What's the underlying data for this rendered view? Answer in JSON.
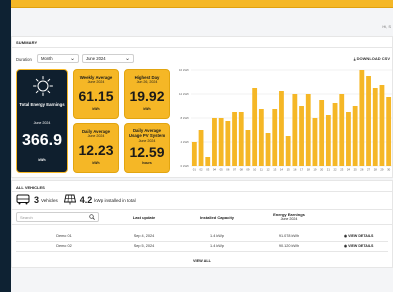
{
  "page": {
    "user_hint": "Hi, S"
  },
  "summary": {
    "title": "SUMMARY",
    "duration_label": "Duration",
    "duration_value": "Month",
    "period_value": "June 2024",
    "download_label": "DOWNLOAD CSV",
    "total": {
      "title": "Total Energy Earnings",
      "period": "June 2024",
      "value": "366.9",
      "unit": "kWh"
    },
    "weekly": {
      "title": "Weekly Average",
      "period": "June 2024",
      "value": "61.15",
      "unit": "kWh"
    },
    "highest": {
      "title": "Highest Day",
      "period": "Jun 26, 2024",
      "value": "19.92",
      "unit": "kWh"
    },
    "daily": {
      "title": "Daily Average",
      "period": "June 2024",
      "value": "12.23",
      "unit": "kWh"
    },
    "pv_usage": {
      "title": "Daily Average Usage PV System",
      "period": "June 2024",
      "value": "12.59",
      "unit": "hours"
    }
  },
  "chart_data": {
    "type": "bar",
    "categories": [
      "01",
      "02",
      "03",
      "04",
      "05",
      "06",
      "07",
      "08",
      "09",
      "10",
      "11",
      "12",
      "13",
      "14",
      "15",
      "16",
      "17",
      "18",
      "19",
      "20",
      "21",
      "22",
      "23",
      "24",
      "25",
      "26",
      "27",
      "28",
      "29",
      "30"
    ],
    "values": [
      4.0,
      6.0,
      1.5,
      8.0,
      8.0,
      7.5,
      9.0,
      9.0,
      6.0,
      13.0,
      9.5,
      5.5,
      9.5,
      12.5,
      5.0,
      12.0,
      10.0,
      12.0,
      8.0,
      11.0,
      8.5,
      10.5,
      12.0,
      9.0,
      10.0,
      19.92,
      15.0,
      13.0,
      13.5,
      11.5
    ],
    "ylim": [
      0,
      16
    ],
    "yticks": [
      "16 kWh",
      "12 kWh",
      "8 kWh",
      "4 kWh",
      "0 kWh"
    ],
    "ytick_values": [
      16,
      12,
      8,
      4,
      0
    ],
    "grid": true,
    "bar_color": "#f5b726"
  },
  "vehicles": {
    "title": "ALL VEHICLES",
    "count": "3",
    "count_label": "Vehicles",
    "installed": "4.2",
    "installed_label": "kWp installed in total",
    "search_placeholder": "Search",
    "columns": [
      "Last update",
      "Installed Capacity",
      "Energy Earnings",
      "June 2024"
    ],
    "rows": [
      {
        "name": "Demo 01",
        "last_update": "Sep 4, 2024",
        "capacity": "1.4 kWp",
        "earnings": "91.078 kWh",
        "action": "VIEW DETAILS"
      },
      {
        "name": "Demo 02",
        "last_update": "Sep 5, 2024",
        "capacity": "1.4 kWp",
        "earnings": "90.120 kWh",
        "action": "VIEW DETAILS"
      }
    ],
    "view_all": "VIEW ALL"
  },
  "colors": {
    "accent": "#f5b726",
    "dark": "#0f1f2e",
    "sidebar": "#0e2233"
  },
  "icons": [
    "sun-icon",
    "search-icon",
    "chevron-down-icon",
    "download-icon",
    "car-icon",
    "solar-panel-icon",
    "eye-icon"
  ]
}
